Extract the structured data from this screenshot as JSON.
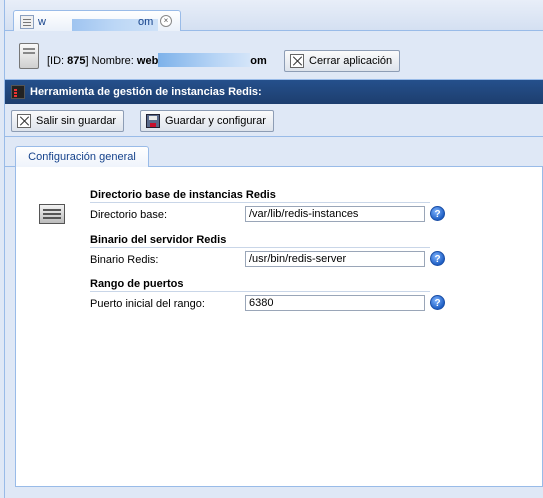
{
  "window_tab": {
    "title_start": "w",
    "title_end": "om"
  },
  "infobar": {
    "id_prefix": "[ID: ",
    "id_value": "875",
    "name_label": "] Nombre: ",
    "name_start": "web",
    "name_end": "om",
    "close_app_label": "Cerrar aplicación"
  },
  "tool": {
    "title": "Herramienta de gestión de instancias Redis:"
  },
  "toolbar": {
    "exit_label": "Salir sin guardar",
    "save_label": "Guardar y configurar"
  },
  "form_tabs": [
    {
      "label": "Configuración general"
    }
  ],
  "sections": [
    {
      "title": "Directorio base de instancias Redis",
      "field_label": "Directorio base:",
      "field_value": "/var/lib/redis-instances"
    },
    {
      "title": "Binario del servidor Redis",
      "field_label": "Binario Redis:",
      "field_value": "/usr/bin/redis-server"
    },
    {
      "title": "Rango de puertos",
      "field_label": "Puerto inicial del rango:",
      "field_value": "6380"
    }
  ],
  "icons": {
    "tab": "document-icon",
    "tab_close": "close-circle-icon",
    "server": "server-icon",
    "close": "close-box-icon",
    "save": "floppy-icon",
    "tool": "terminal-icon",
    "panel": "server-rack-icon",
    "help": "help-icon"
  },
  "colors": {
    "accent": "#15428b",
    "titlebar": "#1d3e6e",
    "background": "#dfe8f6",
    "border": "#99bbe8"
  }
}
